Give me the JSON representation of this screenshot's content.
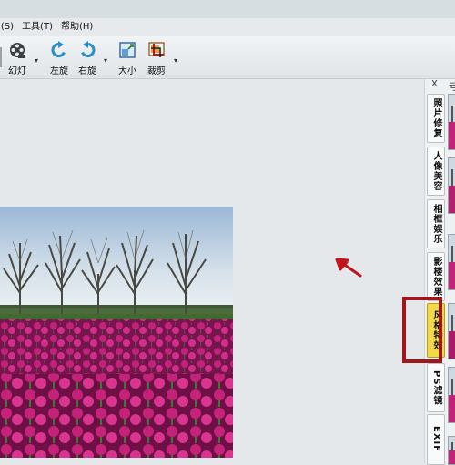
{
  "menu": {
    "items": [
      ")(S)",
      "工具(T)",
      "帮助(H)"
    ]
  },
  "toolbar": {
    "slideshow": "幻灯",
    "rotate_left": "左旋",
    "rotate_right": "右旋",
    "resize": "大小",
    "crop": "裁剪"
  },
  "sidebar": {
    "close": "X",
    "header_partial": "亏",
    "tabs": [
      {
        "label": "照片修复",
        "active": false
      },
      {
        "label": "人像美容",
        "active": false
      },
      {
        "label": "相框娱乐",
        "active": false
      },
      {
        "label": "影楼效果",
        "active": false
      },
      {
        "label": "风格特效",
        "active": true
      },
      {
        "label": "PS滤镜",
        "active": false
      },
      {
        "label": "EXIF",
        "active": false
      }
    ]
  },
  "colors": {
    "active_tab": "#f3d84a",
    "highlight": "#a1161a",
    "arrow": "#c0141c"
  },
  "icons": {
    "slideshow": "film-reel-icon",
    "rotate_left": "rotate-left-icon",
    "rotate_right": "rotate-right-icon",
    "resize": "resize-icon",
    "crop": "crop-icon"
  }
}
